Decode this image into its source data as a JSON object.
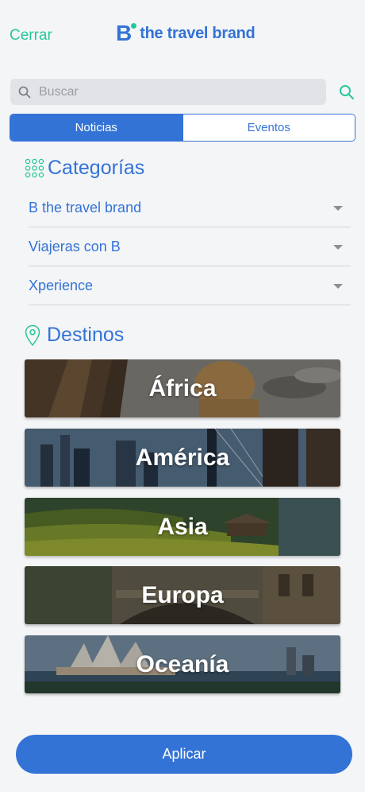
{
  "header": {
    "close_label": "Cerrar",
    "brand_letter": "B",
    "brand_name": "the travel brand"
  },
  "search": {
    "placeholder": "Buscar"
  },
  "tabs": [
    {
      "label": "Noticias",
      "active": true
    },
    {
      "label": "Eventos",
      "active": false
    }
  ],
  "categories": {
    "title": "Categorías",
    "items": [
      {
        "label": "B the travel brand"
      },
      {
        "label": "Viajeras con B"
      },
      {
        "label": "Xperience"
      }
    ]
  },
  "destinations": {
    "title": "Destinos",
    "items": [
      {
        "label": "África"
      },
      {
        "label": "América"
      },
      {
        "label": "Asia"
      },
      {
        "label": "Europa"
      },
      {
        "label": "Oceanía"
      }
    ]
  },
  "apply_label": "Aplicar",
  "colors": {
    "primary": "#3473d6",
    "accent": "#27c79a",
    "background": "#f4f5f7"
  },
  "icons": [
    "search-icon",
    "search-button-icon",
    "grid-icon",
    "location-pin-icon",
    "chevron-down-icon"
  ]
}
